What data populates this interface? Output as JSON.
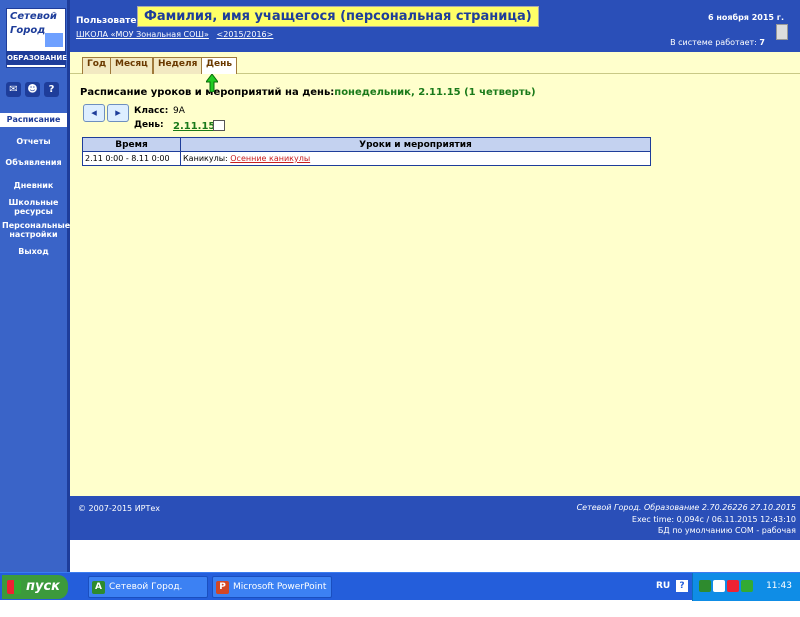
{
  "logo": {
    "line1": "Сетевой",
    "line2": "Город",
    "line3": "ОБРАЗОВАНИЕ"
  },
  "sidebar": {
    "icons": [
      "mail-icon",
      "people-icon",
      "help-icon"
    ],
    "help_glyph": "?",
    "items": [
      {
        "label": "Расписание",
        "active": true
      },
      {
        "label": "Отчеты"
      },
      {
        "label": "Объявления"
      },
      {
        "label": "Дневник"
      },
      {
        "label": "Школьные ресурсы"
      },
      {
        "label": "Персональные настройки"
      },
      {
        "label": "Выход"
      }
    ]
  },
  "header": {
    "user_label": "Пользователь",
    "tooltip": "Фамилия, имя учащегося (персональная страница)",
    "school_link": "ШКОЛА «МОУ Зональная СОШ»",
    "year_link": "<2015/2016>",
    "date": "6 ноября 2015 г.",
    "online_label": "В системе работает:",
    "online_count": "7"
  },
  "tabs": [
    "Год",
    "Месяц",
    "Неделя",
    "День"
  ],
  "schedule": {
    "title": "Расписание уроков и мероприятий на день:",
    "title_value": "понедельник, 2.11.15 (1 четверть)",
    "prev_glyph": "◂",
    "next_glyph": "▸",
    "class_label": "Класс:",
    "class_value": "9А",
    "day_label": "День:",
    "day_value": "2.11.15",
    "columns": [
      "Время",
      "Уроки и мероприятия"
    ],
    "rows": [
      {
        "time": "2.11 0:00 - 8.11 0:00",
        "event_prefix": "Каникулы:",
        "event_link": "Осенние каникулы"
      }
    ]
  },
  "footer": {
    "copyright": "© 2007-2015 ИРТех",
    "version": "Сетевой Город. Образование 2.70.26226   27.10.2015",
    "exec": "Exec time: 0,094с / 06.11.2015 12:43:10",
    "db": "БД по умолчанию COM - рабочая"
  },
  "taskbar": {
    "start_label": "пуск",
    "tasks": [
      {
        "label": "Сетевой Город. Обр...",
        "icon": "A"
      },
      {
        "label": "Microsoft PowerPoint ...",
        "icon": "P"
      }
    ],
    "lang": "RU",
    "help_glyph": "?",
    "clock": "11:43"
  },
  "colors": {
    "primary": "#2a4fb8",
    "background": "#ffffcc",
    "link_red": "#c81e1e",
    "accent_green": "#1a7a1a"
  }
}
